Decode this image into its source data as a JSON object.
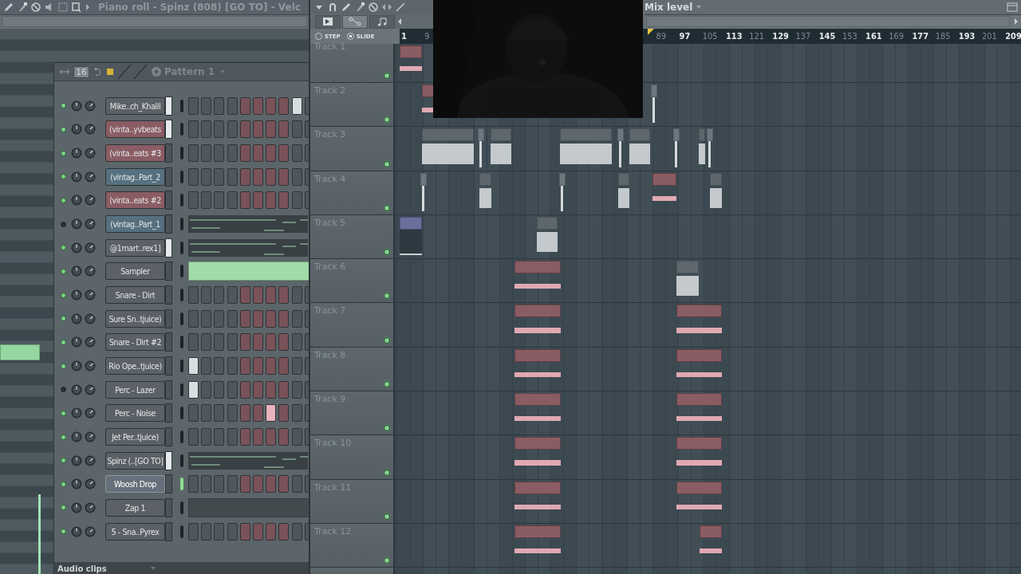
{
  "piano_roll": {
    "title": "Piano roll - Spinz (808) [GO TO] - Velc"
  },
  "playlist": {
    "mix_label": "Mix level",
    "tabs": [
      {
        "kind": "playlist",
        "selected": false
      },
      {
        "kind": "automation",
        "selected": true
      },
      {
        "kind": "notes",
        "selected": false
      }
    ],
    "snap": [
      {
        "label": "STEP",
        "selected": false
      },
      {
        "label": "SLIDE",
        "selected": true
      }
    ],
    "ruler_left": [
      {
        "label": "1",
        "strong": true
      },
      {
        "label": "9",
        "strong": false
      }
    ],
    "ruler_right": [
      {
        "label": "89",
        "strong": false
      },
      {
        "label": "97",
        "strong": true
      },
      {
        "label": "105",
        "strong": false
      },
      {
        "label": "113",
        "strong": true
      },
      {
        "label": "121",
        "strong": false
      },
      {
        "label": "129",
        "strong": true
      },
      {
        "label": "137",
        "strong": false
      },
      {
        "label": "145",
        "strong": true
      },
      {
        "label": "153",
        "strong": false
      },
      {
        "label": "161",
        "strong": true
      },
      {
        "label": "169",
        "strong": false
      },
      {
        "label": "177",
        "strong": true
      },
      {
        "label": "185",
        "strong": false
      },
      {
        "label": "193",
        "strong": true
      },
      {
        "label": "201",
        "strong": false
      },
      {
        "label": "209",
        "strong": true
      }
    ],
    "tracks": [
      {
        "name": "Track 1",
        "enabled": true
      },
      {
        "name": "Track 2",
        "enabled": true
      },
      {
        "name": "Track 3",
        "enabled": true
      },
      {
        "name": "Track 4",
        "enabled": true
      },
      {
        "name": "Track 5",
        "enabled": true
      },
      {
        "name": "Track 6",
        "enabled": true
      },
      {
        "name": "Track 7",
        "enabled": true
      },
      {
        "name": "Track 8",
        "enabled": true
      },
      {
        "name": "Track 9",
        "enabled": true
      },
      {
        "name": "Track 10",
        "enabled": true
      },
      {
        "name": "Track 11",
        "enabled": true
      },
      {
        "name": "Track 12",
        "enabled": true
      }
    ]
  },
  "channel_rack": {
    "steps_count": "16",
    "pattern": "Pattern 1",
    "filter": "Audio clips",
    "channels": [
      {
        "name": "Mike..ch_Khalil",
        "color": "#5b6166",
        "enabled": true,
        "selected": true,
        "active": false,
        "kind": "steps",
        "steps": [
          false,
          false,
          false,
          false,
          false,
          false,
          false,
          false,
          true,
          false
        ]
      },
      {
        "name": "(vinta..yvbeats",
        "color": "#8a5c63",
        "enabled": true,
        "selected": true,
        "active": false,
        "kind": "steps",
        "steps": [
          false,
          false,
          false,
          false,
          false,
          false,
          false,
          false,
          false,
          false
        ]
      },
      {
        "name": "(vinta..eats #3",
        "color": "#8a5c63",
        "enabled": true,
        "selected": false,
        "active": false,
        "kind": "steps",
        "steps": [
          false,
          false,
          false,
          false,
          false,
          false,
          false,
          false,
          false,
          false
        ]
      },
      {
        "name": "(vintag..Part_2",
        "color": "#56707f",
        "enabled": true,
        "selected": false,
        "active": false,
        "kind": "steps",
        "steps": [
          false,
          false,
          false,
          false,
          false,
          false,
          false,
          false,
          false,
          false
        ]
      },
      {
        "name": "(vinta..eats #2",
        "color": "#8a5c63",
        "enabled": true,
        "selected": false,
        "active": false,
        "kind": "steps",
        "steps": [
          false,
          false,
          false,
          false,
          false,
          false,
          false,
          false,
          false,
          false
        ]
      },
      {
        "name": "(vintag..Part_1",
        "color": "#56707f",
        "enabled": false,
        "selected": false,
        "active": false,
        "kind": "notes"
      },
      {
        "name": "@1mart..rex1]",
        "color": "#5b6166",
        "enabled": true,
        "selected": true,
        "active": false,
        "kind": "notes"
      },
      {
        "name": "Sampler",
        "color": "#5b6166",
        "enabled": true,
        "selected": false,
        "active": false,
        "kind": "filled"
      },
      {
        "name": "Snare - Dirt",
        "color": "#5b6166",
        "enabled": true,
        "selected": false,
        "active": false,
        "kind": "steps",
        "steps": [
          false,
          false,
          false,
          false,
          false,
          false,
          false,
          false,
          false,
          false
        ]
      },
      {
        "name": "Sure Sn..tjuice)",
        "color": "#5b6166",
        "enabled": true,
        "selected": false,
        "active": false,
        "kind": "steps",
        "steps": [
          false,
          false,
          false,
          false,
          false,
          false,
          false,
          false,
          false,
          false
        ]
      },
      {
        "name": "Snare - Dirt #2",
        "color": "#5b6166",
        "enabled": true,
        "selected": false,
        "active": false,
        "kind": "steps",
        "steps": [
          false,
          false,
          false,
          false,
          false,
          false,
          false,
          false,
          false,
          false
        ]
      },
      {
        "name": "Rio Ope..tjuice)",
        "color": "#5b6166",
        "enabled": true,
        "selected": false,
        "active": false,
        "kind": "steps",
        "steps": [
          true,
          false,
          false,
          false,
          false,
          false,
          false,
          false,
          false,
          false
        ]
      },
      {
        "name": "Perc - Lazer",
        "color": "#5b6166",
        "enabled": false,
        "selected": false,
        "active": false,
        "kind": "steps",
        "steps": [
          true,
          false,
          false,
          false,
          false,
          false,
          false,
          false,
          false,
          false
        ]
      },
      {
        "name": "Perc - Noise",
        "color": "#5b6166",
        "enabled": true,
        "selected": false,
        "active": false,
        "kind": "steps",
        "steps": [
          false,
          false,
          false,
          false,
          false,
          false,
          true,
          false,
          false,
          false
        ]
      },
      {
        "name": "Jet Per..tjuice)",
        "color": "#5b6166",
        "enabled": true,
        "selected": false,
        "active": false,
        "kind": "steps",
        "steps": [
          false,
          false,
          false,
          false,
          false,
          false,
          false,
          false,
          false,
          false
        ]
      },
      {
        "name": "Spinz (..[GO TO]",
        "color": "#5b6166",
        "enabled": true,
        "selected": true,
        "active": false,
        "kind": "notes"
      },
      {
        "name": "Woosh Drop",
        "color": "#66707a",
        "enabled": true,
        "selected": false,
        "active": true,
        "kind": "steps",
        "steps": [
          false,
          false,
          false,
          false,
          false,
          false,
          false,
          false,
          false,
          false
        ]
      },
      {
        "name": "Zap 1",
        "color": "#5b6166",
        "enabled": true,
        "selected": false,
        "active": false,
        "kind": "empty"
      },
      {
        "name": "5 - Sna..Pyrex",
        "color": "#5b6166",
        "enabled": true,
        "selected": false,
        "active": false,
        "kind": "steps",
        "steps": [
          false,
          false,
          false,
          false,
          false,
          false,
          false,
          false,
          false,
          false
        ]
      }
    ]
  }
}
